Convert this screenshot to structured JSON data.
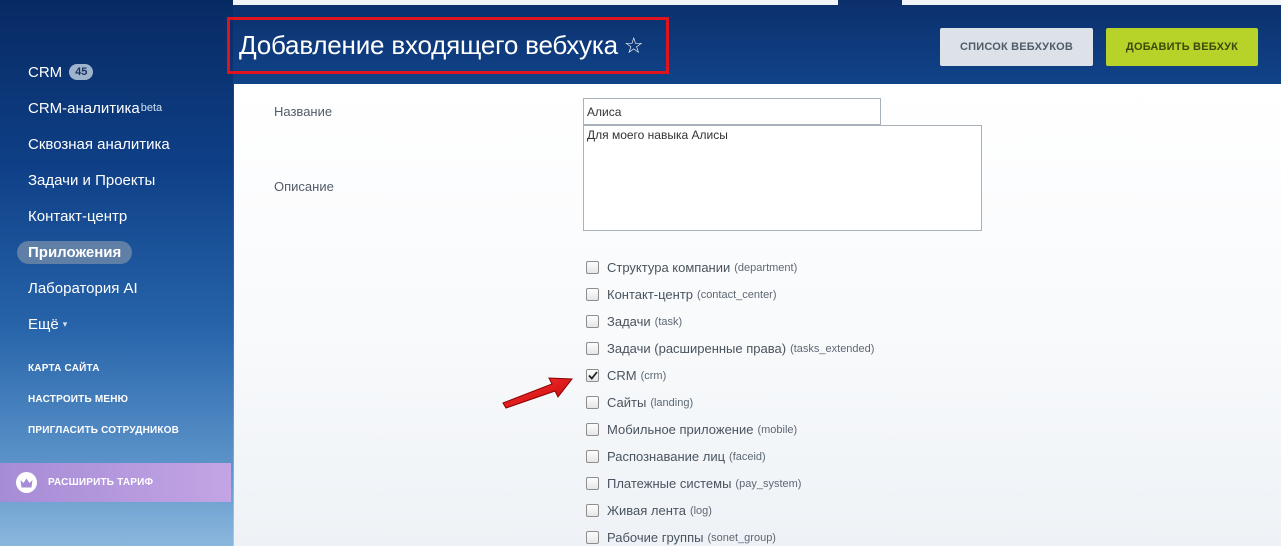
{
  "sidebar": {
    "items": [
      {
        "label": "CRM",
        "badge": "45"
      },
      {
        "label": "CRM-аналитика",
        "sup": "beta"
      },
      {
        "label": "Сквозная аналитика"
      },
      {
        "label": "Задачи и Проекты"
      },
      {
        "label": "Контакт-центр"
      },
      {
        "label": "Приложения",
        "active": true
      },
      {
        "label": "Лаборатория AI"
      },
      {
        "label": "Ещё",
        "chevron": "▾"
      }
    ],
    "links": [
      "КАРТА САЙТА",
      "НАСТРОИТЬ МЕНЮ",
      "ПРИГЛАСИТЬ СОТРУДНИКОВ"
    ],
    "upgrade_label": "РАСШИРИТЬ ТАРИФ",
    "upgrade_icon": "crown-icon"
  },
  "header": {
    "title": "Добавление входящего вебхука",
    "star": "☆",
    "list_button": "СПИСОК ВЕБХУКОВ",
    "add_button": "ДОБАВИТЬ ВЕБХУК"
  },
  "form": {
    "name_label": "Название",
    "name_value": "Алиса",
    "description_label": "Описание",
    "description_value": "Для моего навыка Алисы",
    "permissions": [
      {
        "name": "Структура компании",
        "code": "(department)",
        "checked": false
      },
      {
        "name": "Контакт-центр",
        "code": "(contact_center)",
        "checked": false
      },
      {
        "name": "Задачи",
        "code": "(task)",
        "checked": false
      },
      {
        "name": "Задачи (расширенные права)",
        "code": "(tasks_extended)",
        "checked": false
      },
      {
        "name": "CRM",
        "code": "(crm)",
        "checked": true
      },
      {
        "name": "Сайты",
        "code": "(landing)",
        "checked": false
      },
      {
        "name": "Мобильное приложение",
        "code": "(mobile)",
        "checked": false
      },
      {
        "name": "Распознавание лиц",
        "code": "(faceid)",
        "checked": false
      },
      {
        "name": "Платежные системы",
        "code": "(pay_system)",
        "checked": false
      },
      {
        "name": "Живая лента",
        "code": "(log)",
        "checked": false
      },
      {
        "name": "Рабочие группы",
        "code": "(sonet_group)",
        "checked": false
      }
    ]
  },
  "colors": {
    "accent_green": "#b7d32a",
    "highlight_red": "#e0141e",
    "upgrade_purple": "#b399dc"
  }
}
